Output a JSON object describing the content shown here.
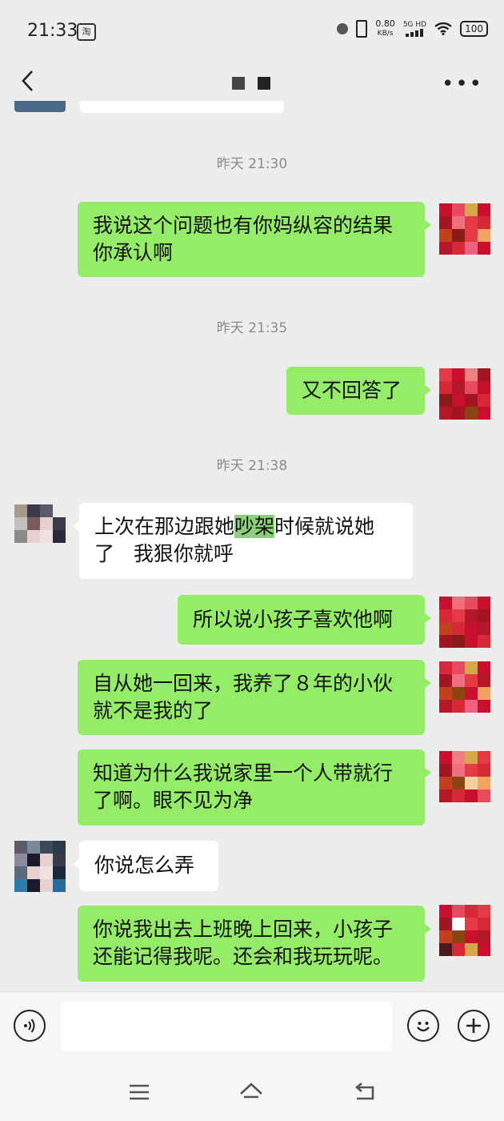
{
  "status_bar": {
    "time": "21:33",
    "app_badge": "淘",
    "speed_value": "0.80",
    "speed_unit": "KB/s",
    "network": "5G HD",
    "battery": "100"
  },
  "header": {
    "back_icon": "chevron-left-icon",
    "more_icon": "more-dots-icon"
  },
  "chat": {
    "timestamps": [
      "昨天 21:30",
      "昨天 21:35",
      "昨天 21:38"
    ],
    "messages": [
      {
        "side": "sent",
        "lines": [
          "我说这个问题也有你妈纵容的结果",
          "你承认啊"
        ]
      },
      {
        "side": "sent",
        "lines": [
          "又不回答了"
        ]
      },
      {
        "side": "recv",
        "line1_pre": "上次在那边跟她",
        "line1_hl": "吵架",
        "line1_post": "时候就说她",
        "line2": "了   我狠你就呼"
      },
      {
        "side": "sent",
        "lines": [
          "所以说小孩子喜欢他啊"
        ]
      },
      {
        "side": "sent",
        "lines": [
          "自从她一回来，我养了８年的小伙",
          "就不是我的了"
        ]
      },
      {
        "side": "sent",
        "lines": [
          "知道为什么我说家里一个人带就行",
          "了啊。眼不见为净"
        ]
      },
      {
        "side": "recv",
        "lines": [
          "你说怎么弄"
        ]
      },
      {
        "side": "sent",
        "lines": [
          "你说我出去上班晚上回来，小孩子",
          "还能记得我呢。还会和我玩玩呢。"
        ]
      }
    ]
  },
  "input_bar": {
    "voice_icon": "voice-icon",
    "emoji_icon": "emoji-icon",
    "plus_icon": "plus-icon"
  },
  "nav": {
    "menu_icon": "menu-icon",
    "home_icon": "home-icon",
    "back_icon": "back-arrow-icon"
  },
  "colors": {
    "sent_bubble": "#95ec69",
    "recv_bubble": "#ffffff",
    "background": "#ededed"
  }
}
